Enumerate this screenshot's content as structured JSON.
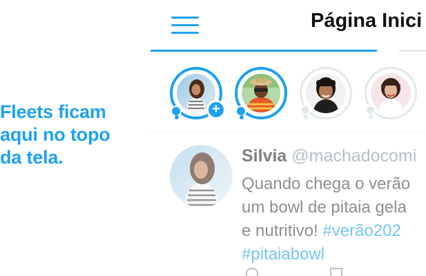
{
  "annotation": {
    "line1": "Fleets ficam",
    "line2": "aqui no topo",
    "line3": "da tela."
  },
  "header": {
    "title": "Página Inici"
  },
  "fleets": [
    {
      "name": "own-fleet",
      "status": "unseen",
      "has_add": true
    },
    {
      "name": "fleet-2",
      "status": "unseen"
    },
    {
      "name": "fleet-3",
      "status": "seen"
    },
    {
      "name": "fleet-4",
      "status": "seen"
    }
  ],
  "tweet": {
    "name": "Silvia",
    "handle": "@machadocomi",
    "line1": "Quando chega o verão",
    "line2": "um bowl de pitaia gela",
    "line3_text": "e nutritivo! ",
    "line3_hashtag": "#verão202",
    "line4_hashtag": "#pitaiabowl"
  },
  "colors": {
    "accent": "#1DA1F2",
    "text": "#111111",
    "muted": "#8899a6",
    "divider": "#e6ecf0"
  }
}
